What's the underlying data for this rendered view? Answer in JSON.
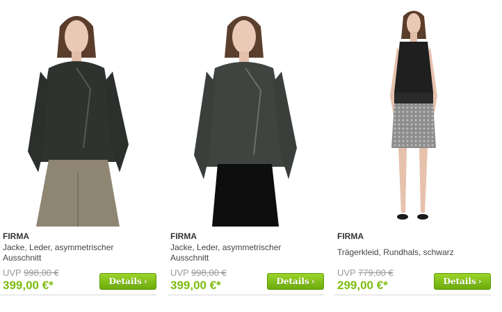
{
  "products": [
    {
      "brand": "FIRMA",
      "title": "Jacke, Leder, asymmetrischer Ausschnitt",
      "uvp_label": "UVP",
      "old_price": "998,00 €",
      "price": "399,00 €*",
      "button_label": "Details",
      "button_icon": "chevron-right-icon",
      "image": "woman-in-dark-leather-jacket-and-beige-trousers"
    },
    {
      "brand": "FIRMA",
      "title": "Jacke, Leder, asymmetrischer Ausschnitt",
      "uvp_label": "UVP",
      "old_price": "998,00 €",
      "price": "399,00 €*",
      "button_label": "Details",
      "button_icon": "chevron-right-icon",
      "image": "woman-in-grey-leather-jacket-and-black-skirt"
    },
    {
      "brand": "FIRMA",
      "title": "Trägerkleid, Rundhals, schwarz",
      "uvp_label": "UVP",
      "old_price": "779,00 €",
      "price": "299,00 €*",
      "button_label": "Details",
      "button_icon": "chevron-right-icon",
      "image": "woman-in-black-sleeveless-dress-with-sequin-skirt"
    }
  ],
  "colors": {
    "price": "#7dbc10",
    "button": "#7cbc14",
    "uvp": "#999999"
  }
}
